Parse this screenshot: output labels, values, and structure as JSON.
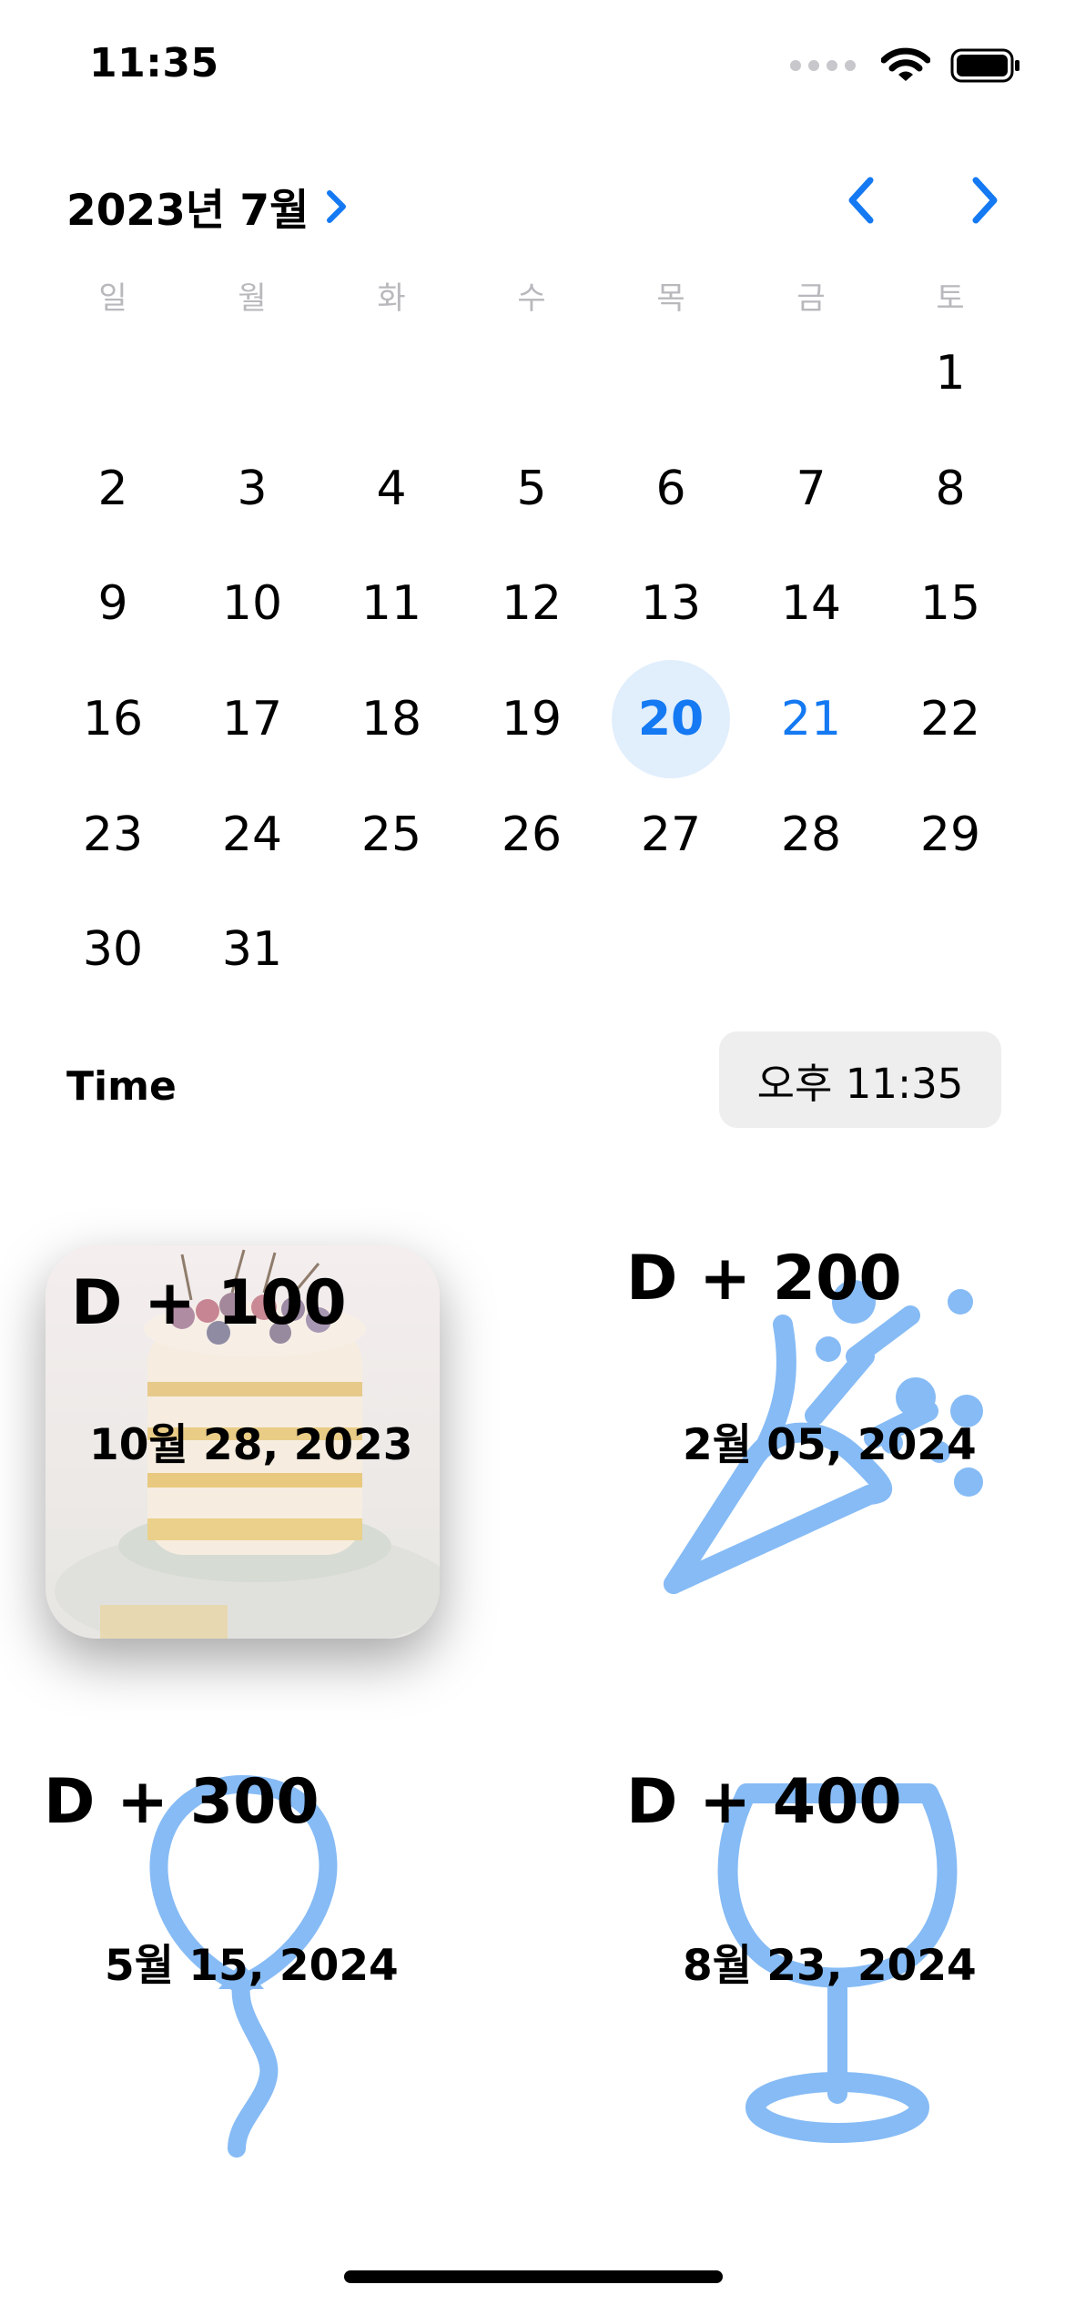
{
  "status_bar": {
    "time": "11:35",
    "icons": [
      "signal-icon",
      "wifi-icon",
      "battery-icon"
    ]
  },
  "calendar": {
    "month_title": "2023년 7월",
    "weekdays": [
      "일",
      "월",
      "화",
      "수",
      "목",
      "금",
      "토"
    ],
    "weeks": [
      [
        "",
        "",
        "",
        "",
        "",
        "",
        "1"
      ],
      [
        "2",
        "3",
        "4",
        "5",
        "6",
        "7",
        "8"
      ],
      [
        "9",
        "10",
        "11",
        "12",
        "13",
        "14",
        "15"
      ],
      [
        "16",
        "17",
        "18",
        "19",
        "20",
        "21",
        "22"
      ],
      [
        "23",
        "24",
        "25",
        "26",
        "27",
        "28",
        "29"
      ],
      [
        "30",
        "31",
        "",
        "",
        "",
        "",
        ""
      ]
    ],
    "selected_day": "20",
    "highlighted_day": "21",
    "accent_color": "#1479f2",
    "selected_bg_color": "#e1eefc"
  },
  "time_row": {
    "label": "Time",
    "value": "오후 11:35"
  },
  "cards": [
    {
      "d_label": "D + 100",
      "date": "10월 28, 2023",
      "art": "cake-photo"
    },
    {
      "d_label": "D + 200",
      "date": "2월 05, 2024",
      "art": "party-popper-icon"
    },
    {
      "d_label": "D + 300",
      "date": "5월 15, 2024",
      "art": "balloon-icon"
    },
    {
      "d_label": "D + 400",
      "date": "8월 23, 2024",
      "art": "wine-glass-icon"
    }
  ],
  "illustration_color": "#86bbf5"
}
